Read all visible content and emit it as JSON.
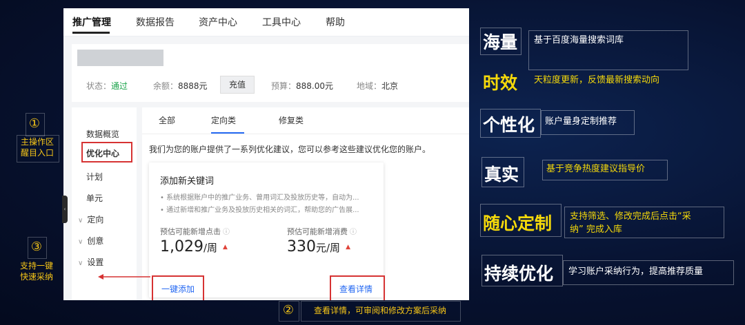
{
  "screenshot": {
    "nav": [
      "推广管理",
      "数据报告",
      "资产中心",
      "工具中心",
      "帮助"
    ],
    "account": {
      "status_label": "状态：",
      "status_value": "通过",
      "balance_label": "余额：",
      "balance_value": "8888元",
      "recharge_button": "充值",
      "budget_label": "预算：",
      "budget_value": "888.00元",
      "region_label": "地域：",
      "region_value": "北京"
    },
    "sidebar": [
      "数据概览",
      "优化中心",
      "计划",
      "单元",
      "定向",
      "创意",
      "设置"
    ],
    "tabs": [
      "全部",
      "定向类",
      "修复类"
    ],
    "intro": "我们为您的账户提供了一系列优化建议，您可以参考这些建议优化您的账户。",
    "card": {
      "title": "添加新关键词",
      "bullets": [
        "系统根据账户中的推广业务、曾用词汇及投放历史等，自动为...",
        "通过新增和推广业务及投放历史相关的词汇，帮助您的广告展..."
      ],
      "clicks_label": "预估可能新增点击",
      "clicks_value": "1,029",
      "clicks_unit": "/周",
      "cost_label": "预估可能新增消费",
      "cost_value": "330",
      "cost_unit": "元/周",
      "add_link": "一键添加",
      "detail_link": "查看详情"
    }
  },
  "annotations": {
    "one": {
      "num": "①",
      "line1": "主操作区",
      "line2": "醒目入口"
    },
    "two": {
      "num": "②",
      "text": "查看详情，可审阅和修改方案后采纳"
    },
    "three": {
      "num": "③",
      "line1": "支持一键",
      "line2": "快速采纳"
    }
  },
  "features": [
    {
      "title": "海量",
      "desc": "基于百度海量搜索词库",
      "title_color": "white",
      "desc_color": "white"
    },
    {
      "title": "时效",
      "desc": "天粒度更新，反馈最新搜索动向",
      "title_color": "yellow",
      "desc_color": "yellow"
    },
    {
      "title": "个性化",
      "desc": "账户量身定制推荐",
      "title_color": "white",
      "desc_color": "white"
    },
    {
      "title": "真实",
      "desc": "基于竞争热度建议指导价",
      "title_color": "white",
      "desc_color": "yellow"
    },
    {
      "title": "随心定制",
      "desc_line1": "支持筛选、修改完成后点击“采",
      "desc_line2": "纳” 完成入库",
      "title_color": "yellow",
      "desc_color": "yellow"
    },
    {
      "title": "持续优化",
      "desc": "学习账户采纳行为，提高推荐质量",
      "title_color": "white",
      "desc_color": "white"
    }
  ],
  "colors": {
    "accent_red": "#d63232",
    "annotation_yellow": "#f5c518",
    "link_blue": "#2468f2"
  }
}
